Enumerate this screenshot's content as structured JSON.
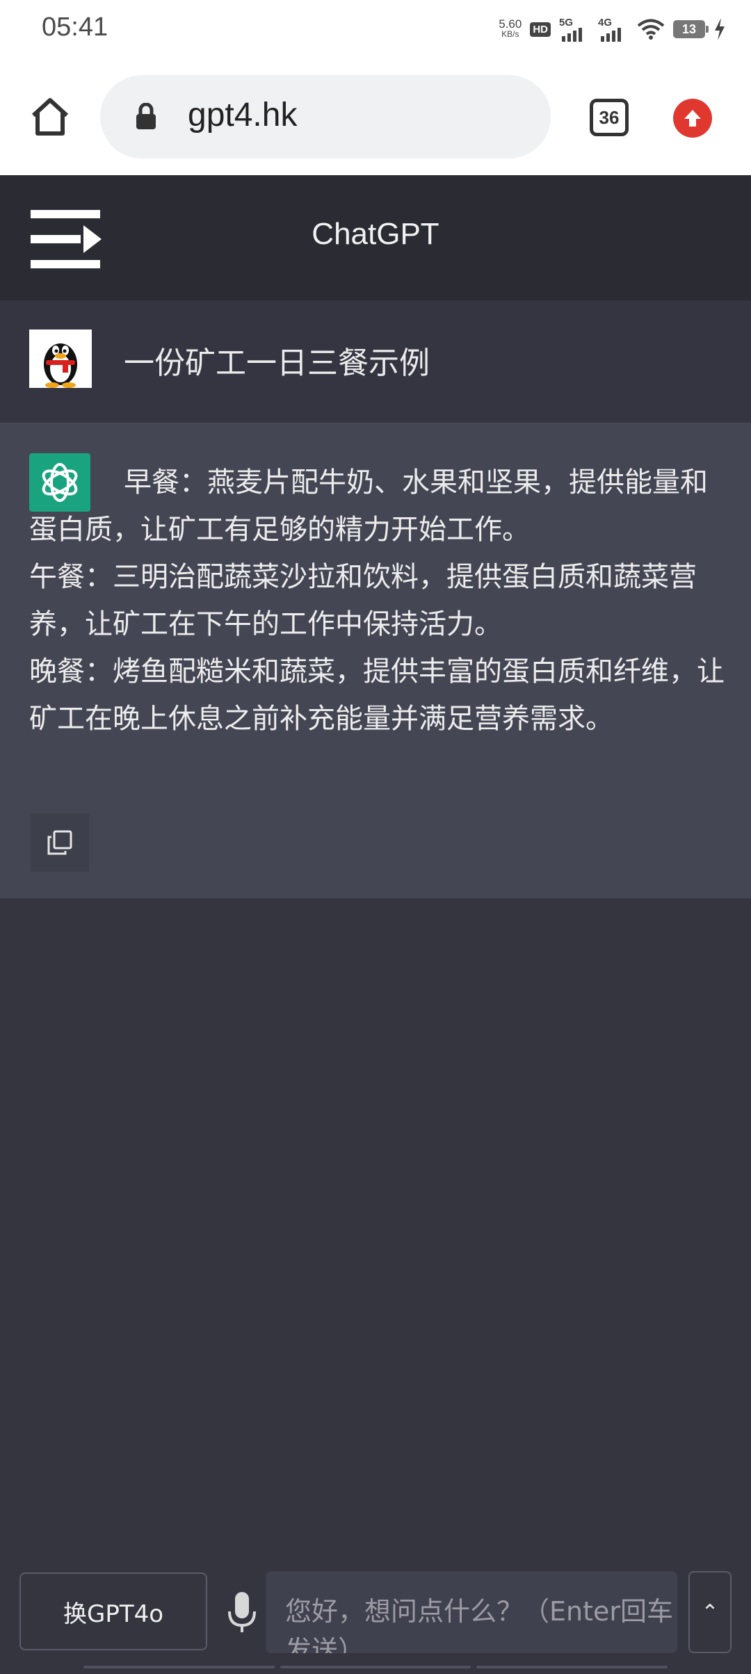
{
  "status_bar": {
    "time": "05:41",
    "net_speed_value": "5.60",
    "net_speed_unit": "KB/s",
    "hd_label": "HD",
    "sim1_label": "5G",
    "sim2_label": "4G",
    "battery": "13"
  },
  "browser": {
    "url": "gpt4.hk",
    "tab_count": "36"
  },
  "header": {
    "title": "ChatGPT"
  },
  "conversation": {
    "user_message": "一份矿工一日三餐示例",
    "assistant_paragraphs": [
      "早餐：燕麦片配牛奶、水果和坚果，提供能量和蛋白质，让矿工有足够的精力开始工作。",
      "午餐：三明治配蔬菜沙拉和饮料，提供蛋白质和蔬菜营养，让矿工在下午的工作中保持活力。",
      "晚餐：烤鱼配糙米和蔬菜，提供丰富的蛋白质和纤维，让矿工在晚上休息之前补充能量并满足营养需求。"
    ]
  },
  "composer": {
    "switch_model_label": "换GPT4o",
    "placeholder": "您好，想问点什么？（Enter回车发送）",
    "send_label": "发送",
    "scroll_up_glyph": "⌃"
  },
  "colors": {
    "header_bg": "#2b2c33",
    "user_row_bg": "#343541",
    "assistant_row_bg": "#444654",
    "gpt_green": "#19a37f",
    "update_red": "#e0382f"
  }
}
